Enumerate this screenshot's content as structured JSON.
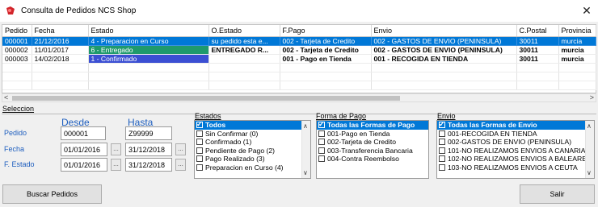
{
  "window": {
    "title": "Consulta de Pedidos NCS Shop"
  },
  "grid": {
    "columns": [
      "Pedido",
      "Fecha",
      "Estado",
      "O.Estado",
      "F.Pago",
      "Envio",
      "C.Postal",
      "Provincia"
    ],
    "rows": [
      {
        "pedido": "000001",
        "fecha": "21/12/2016",
        "estado": "4 - Preparacion en Curso",
        "oestado": "su pedido esta e...",
        "fpago": "002 - Tarjeta de Credito",
        "envio": "002 - GASTOS DE ENVIO (PENINSULA)",
        "cpostal": "30011",
        "provincia": "murcia",
        "selected": true,
        "estado_color": "#f07f1e"
      },
      {
        "pedido": "000002",
        "fecha": "11/01/2017",
        "estado": "6 - Entregado",
        "oestado": "ENTREGADO R...",
        "fpago": "002 - Tarjeta de Credito",
        "envio": "002 - GASTOS DE ENVIO (PENINSULA)",
        "cpostal": "30011",
        "provincia": "murcia",
        "selected": false,
        "estado_color": "#1f9a6c"
      },
      {
        "pedido": "000003",
        "fecha": "14/02/2018",
        "estado": "1 - Confirmado",
        "oestado": "",
        "fpago": "001 - Pago en Tienda",
        "envio": "001 - RECOGIDA EN TIENDA",
        "cpostal": "30011",
        "provincia": "murcia",
        "selected": false,
        "estado_color": "#3b4fd3"
      }
    ]
  },
  "seleccion": {
    "title": "Seleccion",
    "desde_label": "Desde",
    "hasta_label": "Hasta",
    "pedido_label": "Pedido",
    "fecha_label": "Fecha",
    "festado_label": "F. Estado",
    "pedido_desde": "000001",
    "pedido_hasta": "Z99999",
    "fecha_desde": "01/01/2016",
    "fecha_hasta": "31/12/2018",
    "festado_desde": "01/01/2016",
    "festado_hasta": "31/12/2018",
    "dots_label": "..."
  },
  "estados": {
    "title": "Estados",
    "items": [
      "Todos",
      "Sin Confirmar (0)",
      "Confirmado (1)",
      "Pendiente de Pago (2)",
      "Pago Realizado (3)",
      "Preparacion en Curso (4)"
    ]
  },
  "forma_pago": {
    "title": "Forma de Pago",
    "items": [
      "Todas las Formas de Pago",
      "001-Pago en Tienda",
      "002-Tarjeta de Credito",
      "003-Transferencia Bancaria",
      "004-Contra Reembolso"
    ]
  },
  "envio": {
    "title": "Envio",
    "items": [
      "Todas las Formas de Envio",
      "001-RECOGIDA EN TIENDA",
      "002-GASTOS DE ENVIO (PENINSULA)",
      "101-NO REALIZAMOS ENVIOS A CANARIAS",
      "102-NO REALIZAMOS ENVIOS A BALEARES",
      "103-NO REALIZAMOS ENVIOS A CEUTA"
    ]
  },
  "buttons": {
    "buscar": "Buscar Pedidos",
    "salir": "Salir"
  },
  "icons": {
    "app": "shop-app-icon",
    "close": "close-icon"
  },
  "colors": {
    "selection": "#0078d7",
    "label_blue": "#1f5fbf"
  }
}
